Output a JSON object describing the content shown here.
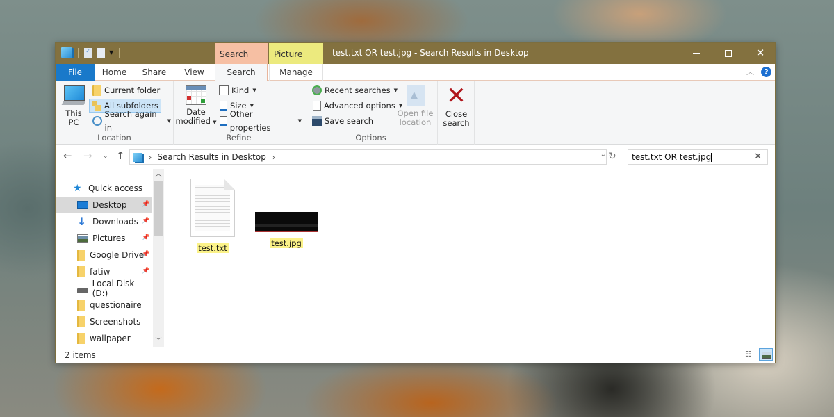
{
  "window": {
    "title": "test.txt OR test.jpg - Search Results in Desktop",
    "controls": {
      "minimize": "minimize",
      "maximize": "maximize",
      "close": "close"
    }
  },
  "quick_access_toolbar": {
    "icons": [
      "app-icon",
      "properties-icon",
      "new-folder-icon",
      "customize-dropdown-icon"
    ]
  },
  "contextual_tabs": {
    "search_tools": {
      "label": "Search Tools",
      "color": "#f6bfa3"
    },
    "picture_tools": {
      "label": "Picture Tools",
      "color": "#ecea7e"
    }
  },
  "tabs": {
    "file": "File",
    "home": "Home",
    "share": "Share",
    "view": "View",
    "search": "Search",
    "manage": "Manage",
    "active": "Search"
  },
  "ribbon": {
    "location": {
      "label": "Location",
      "this_pc": "This PC",
      "current_folder": "Current folder",
      "all_subfolders": "All subfolders",
      "search_again_in": "Search again in"
    },
    "refine": {
      "label": "Refine",
      "date_modified_1": "Date",
      "date_modified_2": "modified",
      "kind": "Kind",
      "size": "Size",
      "other_properties": "Other properties"
    },
    "options": {
      "label": "Options",
      "recent_searches": "Recent searches",
      "advanced_options": "Advanced options",
      "save_search": "Save search",
      "open_file_location_1": "Open file",
      "open_file_location_2": "location"
    },
    "close": {
      "close_search_1": "Close",
      "close_search_2": "search"
    }
  },
  "navigation": {
    "address": "Search Results in Desktop",
    "search_value": "test.txt OR test.jpg"
  },
  "sidebar": {
    "items": [
      {
        "label": "Quick access",
        "icon": "quick-access-star-icon",
        "pinned": false
      },
      {
        "label": "Desktop",
        "icon": "desktop-icon",
        "pinned": true,
        "selected": true
      },
      {
        "label": "Downloads",
        "icon": "downloads-icon",
        "pinned": true
      },
      {
        "label": "Pictures",
        "icon": "pictures-icon",
        "pinned": true
      },
      {
        "label": "Google Drive",
        "icon": "folder-icon",
        "pinned": true
      },
      {
        "label": "fatiw",
        "icon": "folder-icon",
        "pinned": true
      },
      {
        "label": "Local Disk (D:)",
        "icon": "drive-icon",
        "pinned": false
      },
      {
        "label": "questionaire",
        "icon": "folder-icon",
        "pinned": false
      },
      {
        "label": "Screenshots",
        "icon": "folder-icon",
        "pinned": false
      },
      {
        "label": "wallpaper",
        "icon": "folder-icon",
        "pinned": false
      }
    ]
  },
  "files": [
    {
      "name": "test.txt",
      "type": "text"
    },
    {
      "name": "test.jpg",
      "type": "image"
    }
  ],
  "status": {
    "item_count": "2 items",
    "view": "large-icons"
  }
}
